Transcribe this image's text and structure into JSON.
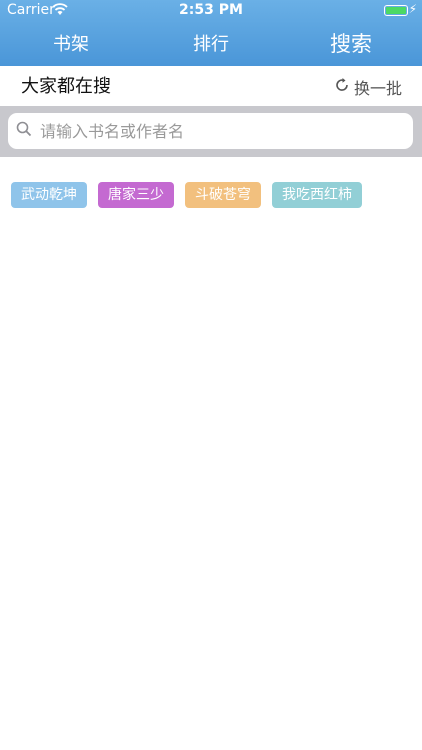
{
  "status_bar": {
    "carrier": "Carrier",
    "time": "2:53 PM"
  },
  "tabs": [
    {
      "label": "书架",
      "active": false
    },
    {
      "label": "排行",
      "active": false
    },
    {
      "label": "搜索",
      "active": true
    }
  ],
  "hot_section": {
    "title": "大家都在搜",
    "refresh_label": "换一批",
    "refresh_icon": "refresh-icon"
  },
  "search": {
    "placeholder": "请输入书名或作者名",
    "value": "",
    "icon": "search-icon"
  },
  "tags": [
    {
      "label": "武动乾坤",
      "color": "#8fc4ea"
    },
    {
      "label": "唐家三少",
      "color": "#c46ad1"
    },
    {
      "label": "斗破苍穹",
      "color": "#f2c07e"
    },
    {
      "label": "我吃西红柿",
      "color": "#92cfd6"
    }
  ],
  "colors": {
    "nav_bar": "#5aa3df",
    "search_band": "#c8c8cd"
  }
}
